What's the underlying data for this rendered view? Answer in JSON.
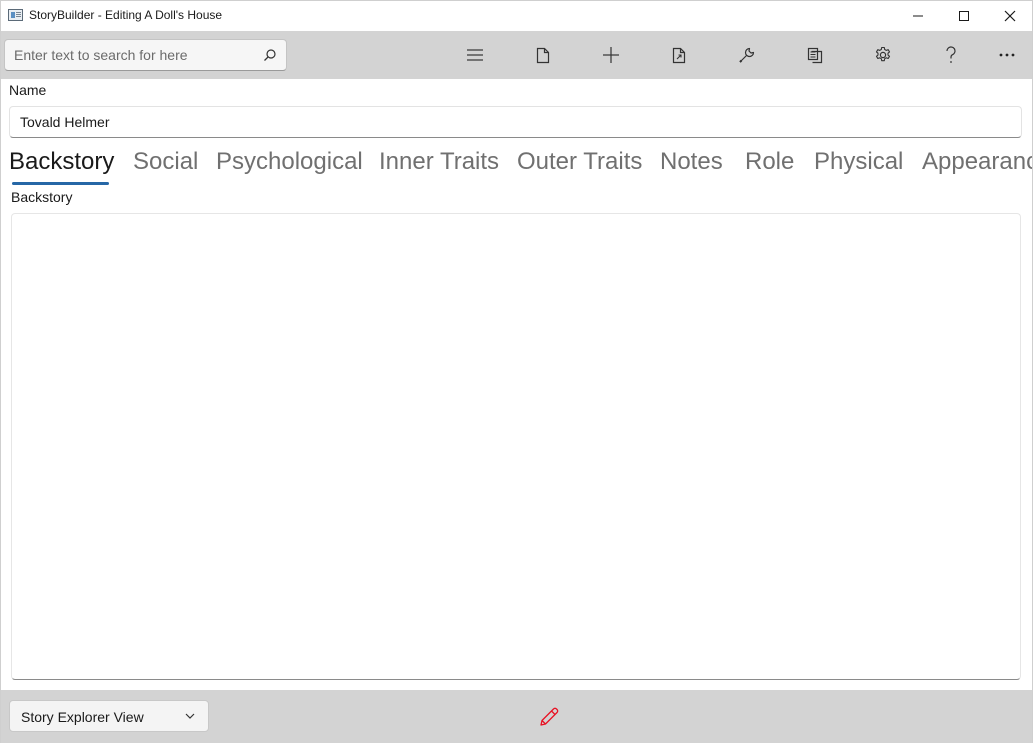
{
  "window": {
    "title": "StoryBuilder - Editing A Doll's House"
  },
  "commandbar": {
    "search_placeholder": "Enter text to search for here",
    "search_value": "",
    "buttons": [
      "menu",
      "new-file",
      "add",
      "open-file",
      "tools",
      "copy",
      "settings",
      "help",
      "more"
    ]
  },
  "form": {
    "name_label": "Name",
    "name_value": "Tovald Helmer"
  },
  "tabs": [
    {
      "label": "Backstory",
      "active": true
    },
    {
      "label": "Social",
      "active": false
    },
    {
      "label": "Psychological",
      "active": false
    },
    {
      "label": "Inner Traits",
      "active": false
    },
    {
      "label": "Outer Traits",
      "active": false
    },
    {
      "label": "Notes",
      "active": false
    },
    {
      "label": "Role",
      "active": false
    },
    {
      "label": "Physical",
      "active": false
    },
    {
      "label": "Appearance",
      "active": false
    }
  ],
  "backstory": {
    "label": "Backstory",
    "value": ""
  },
  "footer": {
    "view_selected": "Story Explorer View",
    "edit_icon_color": "#e81123"
  },
  "colors": {
    "accent": "#2667a6",
    "toolbar_bg": "#d3d3d3"
  }
}
